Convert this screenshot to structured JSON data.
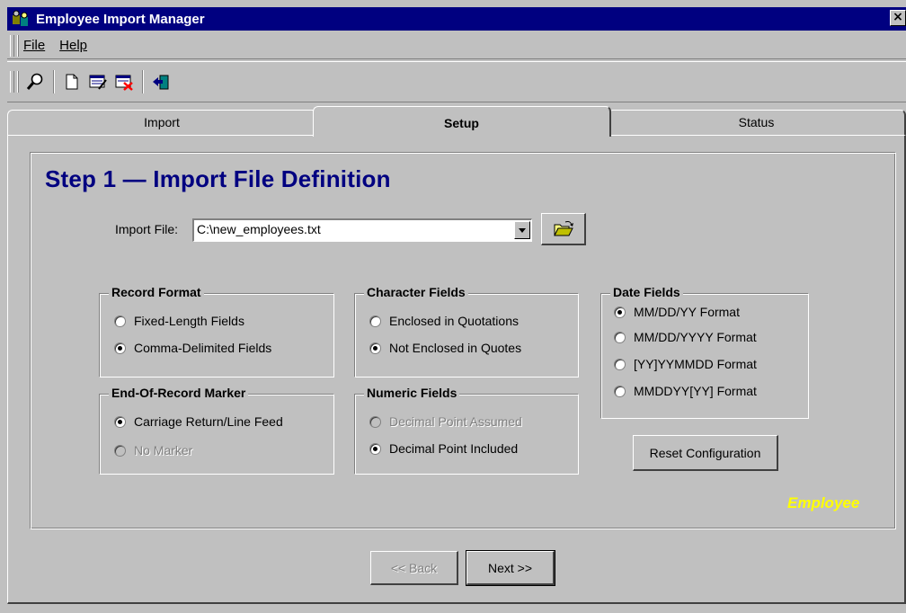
{
  "window": {
    "title": "Employee Import Manager",
    "close_glyph": "×"
  },
  "menu": {
    "items": [
      "File",
      "Help"
    ]
  },
  "toolbar": {
    "icons": [
      "search-icon",
      "new-document-icon",
      "edit-records-icon",
      "delete-records-icon",
      "exit-icon"
    ]
  },
  "tabs": [
    {
      "label": "Import",
      "active": false
    },
    {
      "label": "Setup",
      "active": true
    },
    {
      "label": "Status",
      "active": false
    }
  ],
  "setup": {
    "title": "Step 1 — Import File Definition",
    "import_file_label": "Import File:",
    "import_file_value": "C:\\new_employees.txt",
    "record_format": {
      "title": "Record Format",
      "options": [
        {
          "label": "Fixed-Length Fields",
          "selected": false,
          "enabled": true
        },
        {
          "label": "Comma-Delimited Fields",
          "selected": true,
          "enabled": true
        }
      ]
    },
    "character_fields": {
      "title": "Character Fields",
      "options": [
        {
          "label": "Enclosed in Quotations",
          "selected": false,
          "enabled": true
        },
        {
          "label": "Not Enclosed in Quotes",
          "selected": true,
          "enabled": true
        }
      ]
    },
    "date_fields": {
      "title": "Date Fields",
      "options": [
        {
          "label": "MM/DD/YY Format",
          "selected": true,
          "enabled": true
        },
        {
          "label": "MM/DD/YYYY Format",
          "selected": false,
          "enabled": true
        },
        {
          "label": "[YY]YYMMDD Format",
          "selected": false,
          "enabled": true
        },
        {
          "label": "MMDDYY[YY] Format",
          "selected": false,
          "enabled": true
        }
      ]
    },
    "end_of_record": {
      "title": "End-Of-Record Marker",
      "options": [
        {
          "label": "Carriage Return/Line Feed",
          "selected": true,
          "enabled": true
        },
        {
          "label": "No Marker",
          "selected": false,
          "enabled": false
        }
      ]
    },
    "numeric_fields": {
      "title": "Numeric Fields",
      "options": [
        {
          "label": "Decimal Point Assumed",
          "selected": false,
          "enabled": false
        },
        {
          "label": "Decimal Point Included",
          "selected": true,
          "enabled": true
        }
      ]
    },
    "reset_label": "Reset Configuration",
    "brand_text": "Employee"
  },
  "nav": {
    "back_label": "<< Back",
    "next_label": "Next >>"
  },
  "colors": {
    "title_bar": "#000080",
    "heading": "#000080",
    "brand": "#ffff00",
    "face": "#c0c0c0"
  }
}
